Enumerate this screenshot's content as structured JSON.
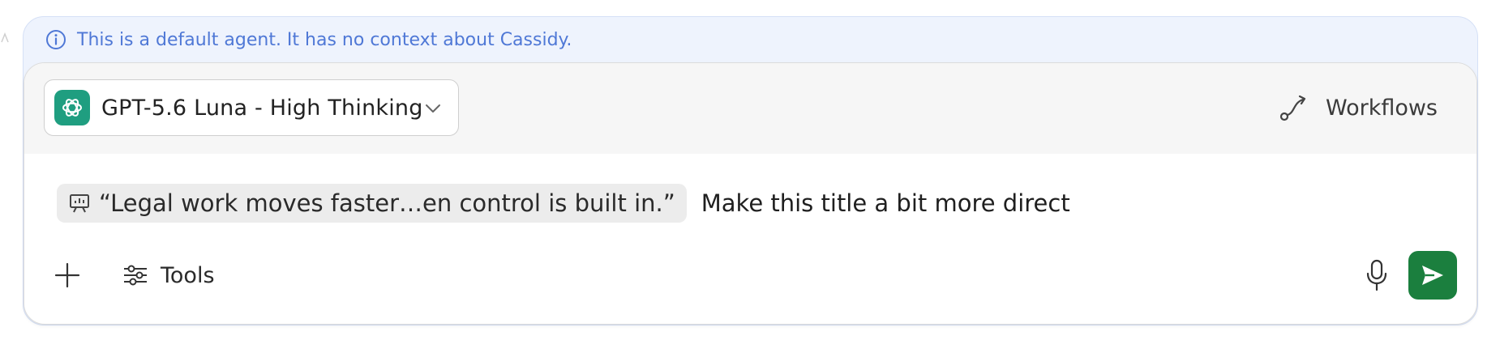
{
  "banner": {
    "text": "This is a default agent. It has no context about Cassidy."
  },
  "model_selector": {
    "label": "GPT-5.6 Luna - High Thinking"
  },
  "workflows": {
    "label": "Workflows"
  },
  "prompt": {
    "chip_text": "“Legal work moves faster…en control is built in.”",
    "text": "Make this title a bit more direct"
  },
  "toolbar": {
    "tools_label": "Tools"
  },
  "colors": {
    "banner_bg": "#eef3fd",
    "banner_text": "#4f78d6",
    "model_logo": "#1f9e80",
    "send_button": "#1b7f3e"
  },
  "icons": [
    "info-icon",
    "openai-logo-icon",
    "chevron-down-icon",
    "workflow-icon",
    "presentation-icon",
    "plus-icon",
    "sliders-icon",
    "microphone-icon",
    "send-icon"
  ]
}
